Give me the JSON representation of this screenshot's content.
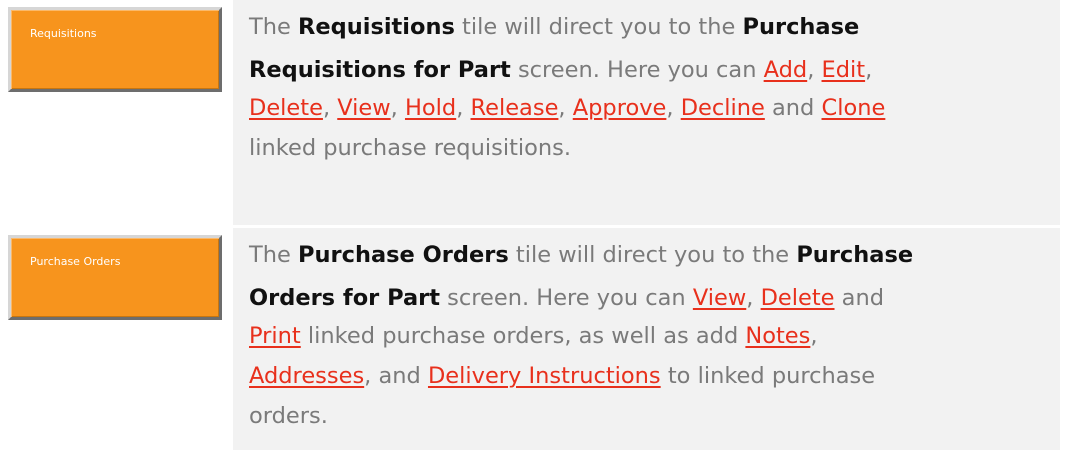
{
  "rows": [
    {
      "tile_label": "Requisitions",
      "text": {
        "the": "The",
        "tile_name": "Requisitions",
        "mid1": "tile will direct you to the",
        "screen_part1": "Purchase",
        "screen_part2": "Requisitions for Part",
        "mid2": "screen. Here you can",
        "links": [
          "Add",
          "Edit",
          "Delete",
          "View",
          "Hold",
          "Release",
          "Approve",
          "Decline",
          "Clone"
        ],
        "sep": ",",
        "and": "and",
        "tail": "linked purchase requisitions."
      }
    },
    {
      "tile_label": "Purchase Orders",
      "text": {
        "the": "The",
        "tile_name": "Purchase Orders",
        "mid1": "tile will direct you to the",
        "screen_part1": "Purchase",
        "screen_part2": "Orders for Part",
        "mid2": "screen. Here you can",
        "links": [
          "View",
          "Delete",
          "Print",
          "Notes",
          "Addresses",
          "Delivery Instructions"
        ],
        "sep": ",",
        "and": "and",
        "mid3": "linked purchase orders, as well as add",
        "and_comma": ", and",
        "tail1": "to linked purchase",
        "tail2": "orders."
      }
    }
  ]
}
